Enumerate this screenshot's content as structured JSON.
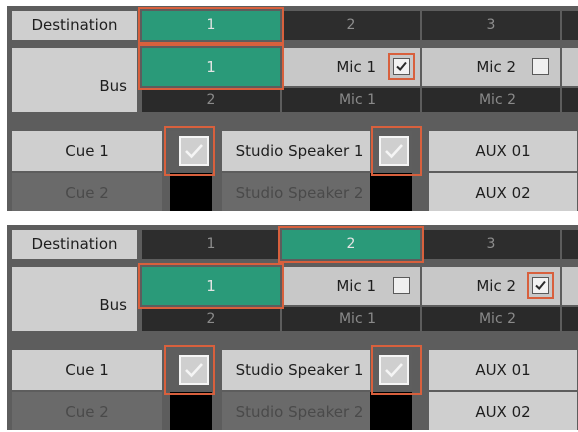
{
  "panels": [
    {
      "destination": {
        "label": "Destination",
        "cells": [
          "1",
          "2",
          "3"
        ],
        "selected": "1"
      },
      "bus": {
        "label": "Bus",
        "top_row": [
          "1",
          "Mic 1",
          "Mic 2"
        ],
        "bottom_row": [
          "2",
          "Mic 1",
          "Mic 2"
        ],
        "mic1_checked": true,
        "mic2_checked": false
      },
      "rows": [
        {
          "label": "Cue 1",
          "col2": "Studio Speaker 1",
          "col3": "AUX 01"
        },
        {
          "label": "Cue 2",
          "col2": "Studio Speaker 2",
          "col3": "AUX 02"
        }
      ]
    },
    {
      "destination": {
        "label": "Destination",
        "cells": [
          "1",
          "2",
          "3"
        ],
        "selected": "2"
      },
      "bus": {
        "label": "Bus",
        "top_row": [
          "1",
          "Mic 1",
          "Mic 2"
        ],
        "bottom_row": [
          "2",
          "Mic 1",
          "Mic 2"
        ],
        "mic1_checked": false,
        "mic2_checked": true
      },
      "rows": [
        {
          "label": "Cue 1",
          "col2": "Studio Speaker 1",
          "col3": "AUX 01"
        },
        {
          "label": "Cue 2",
          "col2": "Studio Speaker 2",
          "col3": "AUX 02"
        }
      ]
    }
  ],
  "colors": {
    "selected": "#2a9a79",
    "highlight": "#d8603d",
    "panel": "#5d5d5d"
  }
}
